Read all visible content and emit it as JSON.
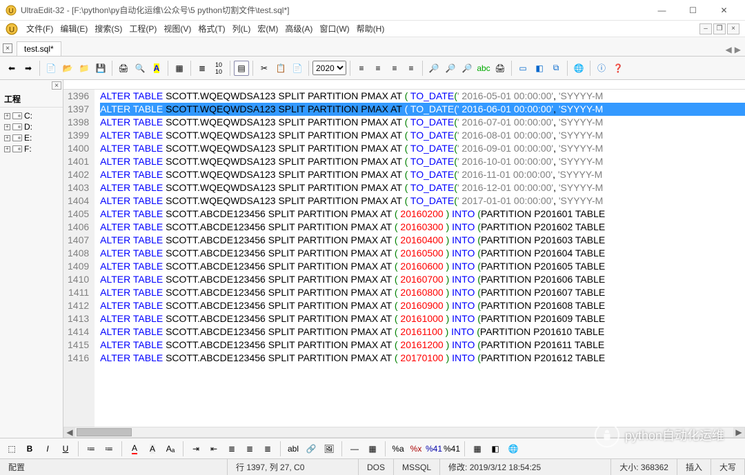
{
  "window": {
    "title": "UltraEdit-32 - [F:\\python\\py自动化运维\\公众号\\5 python切割文件\\test.sql*]"
  },
  "menu": {
    "file": "文件(F)",
    "edit": "编辑(E)",
    "search": "搜索(S)",
    "project": "工程(P)",
    "view": "视图(V)",
    "format": "格式(T)",
    "column": "列(L)",
    "macro": "宏(M)",
    "advanced": "高级(A)",
    "window": "窗口(W)",
    "help": "帮助(H)"
  },
  "tab": {
    "name": "test.sql*"
  },
  "toolbar": {
    "search_value": "2020"
  },
  "sidebar": {
    "title": "工程",
    "drives": [
      "C:",
      "D:",
      "E:",
      "F:"
    ]
  },
  "code": {
    "kw_alter": "ALTER",
    "kw_table": "TABLE",
    "kw_into": "INTO",
    "kw_todate": "TO_DATE",
    "table1": "SCOTT.WQEQWDSA123",
    "table2": "SCOTT.ABCDE123456",
    "split": "SPLIT",
    "partition": "PARTITION",
    "pmax": "PMAX",
    "at": "AT",
    "paren_o": "(",
    "paren_c": ")",
    "fmt": "'SYYYY-M",
    "part_prefix": "PARTITION",
    "tbl_suffix": "TABLE",
    "lines_a": [
      {
        "ln": 1396,
        "date": "' 2016-05-01 00:00:00'"
      },
      {
        "ln": 1397,
        "date": "' 2016-06-01 00:00:00'",
        "selected": true
      },
      {
        "ln": 1398,
        "date": "' 2016-07-01 00:00:00'"
      },
      {
        "ln": 1399,
        "date": "' 2016-08-01 00:00:00'"
      },
      {
        "ln": 1400,
        "date": "' 2016-09-01 00:00:00'"
      },
      {
        "ln": 1401,
        "date": "' 2016-10-01 00:00:00'"
      },
      {
        "ln": 1402,
        "date": "' 2016-11-01 00:00:00'"
      },
      {
        "ln": 1403,
        "date": "' 2016-12-01 00:00:00'"
      },
      {
        "ln": 1404,
        "date": "' 2017-01-01 00:00:00'"
      }
    ],
    "lines_b": [
      {
        "ln": 1405,
        "val": "20160200",
        "part": "P201601"
      },
      {
        "ln": 1406,
        "val": "20160300",
        "part": "P201602"
      },
      {
        "ln": 1407,
        "val": "20160400",
        "part": "P201603"
      },
      {
        "ln": 1408,
        "val": "20160500",
        "part": "P201604"
      },
      {
        "ln": 1409,
        "val": "20160600",
        "part": "P201605"
      },
      {
        "ln": 1410,
        "val": "20160700",
        "part": "P201606"
      },
      {
        "ln": 1411,
        "val": "20160800",
        "part": "P201607"
      },
      {
        "ln": 1412,
        "val": "20160900",
        "part": "P201608"
      },
      {
        "ln": 1413,
        "val": "20161000",
        "part": "P201609"
      },
      {
        "ln": 1414,
        "val": "20161100",
        "part": "P201610"
      },
      {
        "ln": 1415,
        "val": "20161200",
        "part": "P201611"
      },
      {
        "ln": 1416,
        "val": "20170100",
        "part": "P201612"
      }
    ]
  },
  "status": {
    "config": "配置",
    "position": "行 1397, 列 27, C0",
    "lineend": "DOS",
    "syntax": "MSSQL",
    "modified": "修改: 2019/3/12 18:54:25",
    "filesize": "大小: 368362",
    "insert": "插入",
    "caps": "大写"
  },
  "watermark": "python自动化运维"
}
